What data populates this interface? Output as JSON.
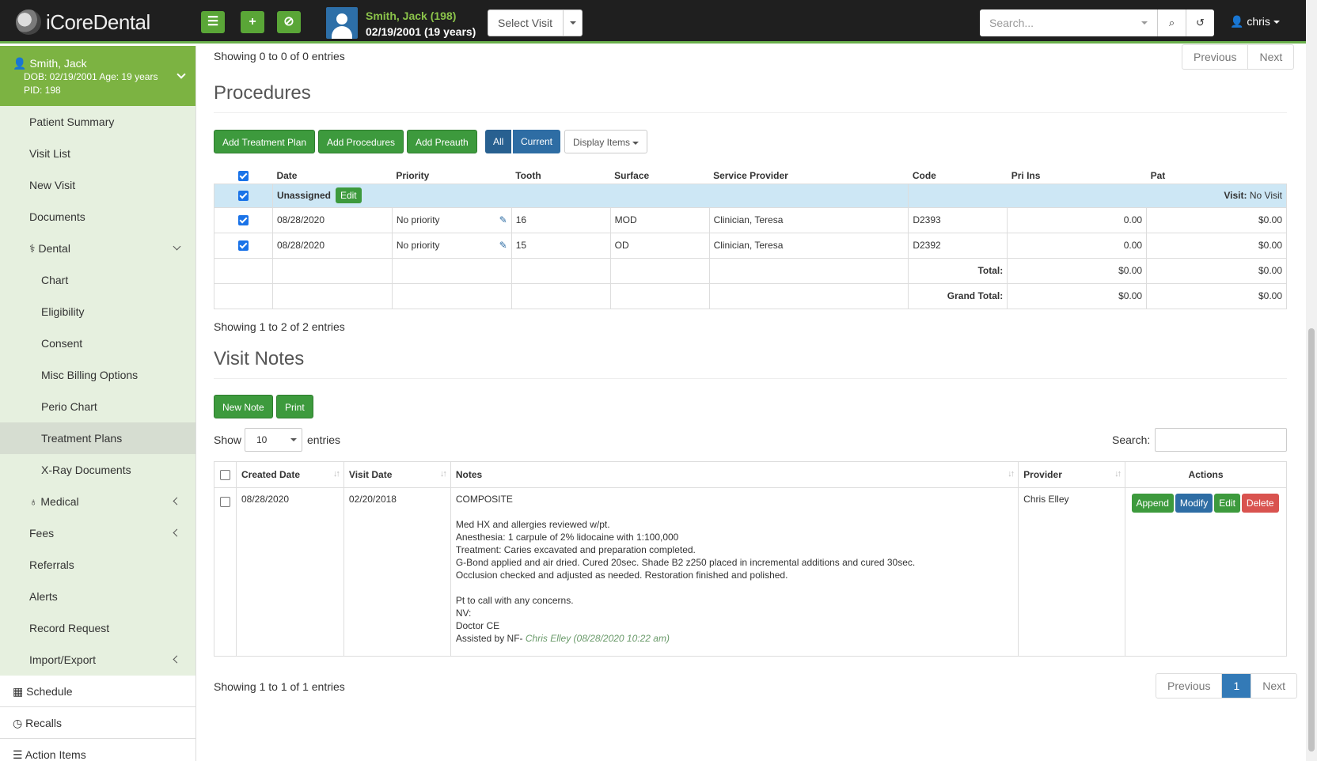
{
  "header": {
    "logo_text": "iCoreDental",
    "patient_name": "Smith, Jack (198)",
    "patient_dob": "02/19/2001 (19 years)",
    "select_visit": "Select Visit",
    "search_placeholder": "Search...",
    "user": "chris"
  },
  "sidebar": {
    "patient_name": "Smith, Jack",
    "patient_dob": "DOB: 02/19/2001 Age: 19 years",
    "patient_pid": "PID: 198",
    "items": [
      {
        "label": "Patient Summary"
      },
      {
        "label": "Visit List"
      },
      {
        "label": "New Visit"
      },
      {
        "label": "Documents"
      },
      {
        "label": "Dental"
      },
      {
        "label": "Chart"
      },
      {
        "label": "Eligibility"
      },
      {
        "label": "Consent"
      },
      {
        "label": "Misc Billing Options"
      },
      {
        "label": "Perio Chart"
      },
      {
        "label": "Treatment Plans"
      },
      {
        "label": "X-Ray Documents"
      },
      {
        "label": "Medical"
      },
      {
        "label": "Fees"
      },
      {
        "label": "Referrals"
      },
      {
        "label": "Alerts"
      },
      {
        "label": "Record Request"
      },
      {
        "label": "Import/Export"
      }
    ],
    "bottom": {
      "schedule": "Schedule",
      "recalls": "Recalls",
      "action_items": "Action Items"
    }
  },
  "top_section": {
    "info": "Showing 0 to 0 of 0 entries",
    "prev": "Previous",
    "next": "Next"
  },
  "procedures": {
    "title": "Procedures",
    "buttons": {
      "add_treatment_plan": "Add Treatment Plan",
      "add_procedures": "Add Procedures",
      "add_preauth": "Add Preauth",
      "all": "All",
      "current": "Current",
      "display_items": "Display Items"
    },
    "columns": [
      "Date",
      "Priority",
      "Tooth",
      "Surface",
      "Service Provider",
      "Code",
      "Pri Ins",
      "Pat"
    ],
    "group_label": "Unassigned",
    "group_edit": "Edit",
    "visit_label": "Visit:",
    "visit_value": "No Visit",
    "rows": [
      {
        "date": "08/28/2020",
        "priority": "No priority",
        "tooth": "16",
        "surface": "MOD",
        "provider": "Clinician, Teresa",
        "code": "D2393",
        "pri_ins": "0.00",
        "pat": "$0.00"
      },
      {
        "date": "08/28/2020",
        "priority": "No priority",
        "tooth": "15",
        "surface": "OD",
        "provider": "Clinician, Teresa",
        "code": "D2392",
        "pri_ins": "0.00",
        "pat": "$0.00"
      }
    ],
    "total_label": "Total:",
    "total_pri": "$0.00",
    "total_pat": "$0.00",
    "grand_label": "Grand Total:",
    "grand_pri": "$0.00",
    "grand_pat": "$0.00",
    "info": "Showing 1 to 2 of 2 entries"
  },
  "visit_notes": {
    "title": "Visit Notes",
    "new_note": "New Note",
    "print": "Print",
    "show_label": "Show",
    "show_value": "10",
    "entries_label": "entries",
    "search_label": "Search:",
    "columns": [
      "Created Date",
      "Visit Date",
      "Notes",
      "Provider",
      "Actions"
    ],
    "row": {
      "created": "08/28/2020",
      "visit": "02/20/2018",
      "note_lines": [
        "COMPOSITE",
        "",
        "Med HX and allergies reviewed w/pt.",
        "Anesthesia: 1 carpule of 2% lidocaine with 1:100,000",
        "Treatment: Caries excavated and preparation completed.",
        "G-Bond applied and air dried. Cured 20sec. Shade B2 z250 placed in incremental additions and cured 30sec.",
        "Occlusion checked and adjusted as needed. Restoration finished and polished.",
        "",
        "Pt to call with any concerns.",
        "NV:",
        "Doctor CE"
      ],
      "assisted": "Assisted by NF-",
      "assisted_sig": "Chris Elley (08/28/2020 10:22 am)",
      "provider": "Chris  Elley",
      "actions": {
        "append": "Append",
        "modify": "Modify",
        "edit": "Edit",
        "delete": "Delete"
      }
    },
    "info": "Showing 1 to 1 of 1 entries",
    "prev": "Previous",
    "page": "1",
    "next": "Next"
  },
  "colors": {
    "brand_green": "#7cb342",
    "button_green": "#3d9a3d",
    "blue": "#2e6da4",
    "danger": "#d9534f"
  }
}
